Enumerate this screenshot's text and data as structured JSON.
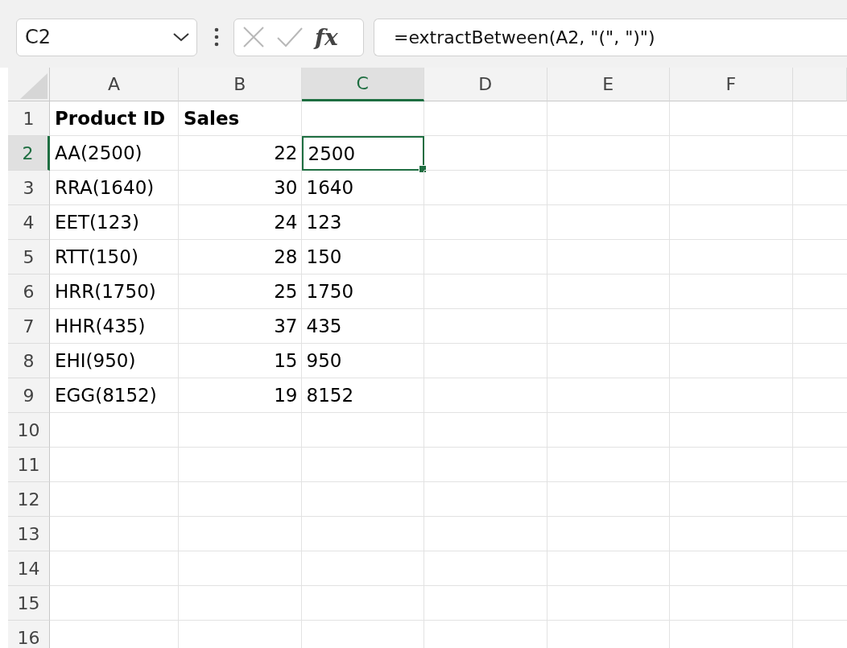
{
  "name_box": {
    "value": "C2"
  },
  "formula_bar": {
    "function_label": "fx",
    "value": "=extractBetween(A2, \"(\", \")\")"
  },
  "columns": [
    {
      "label": "A",
      "selected": false
    },
    {
      "label": "B",
      "selected": false
    },
    {
      "label": "C",
      "selected": true
    },
    {
      "label": "D",
      "selected": false
    },
    {
      "label": "E",
      "selected": false
    },
    {
      "label": "F",
      "selected": false
    }
  ],
  "rows": [
    {
      "header": "1",
      "selected": false,
      "cells": [
        {
          "text": "Product ID",
          "kind": "text",
          "bold": true,
          "selected": false
        },
        {
          "text": "Sales",
          "kind": "text",
          "bold": true,
          "selected": false
        }
      ]
    },
    {
      "header": "2",
      "selected": true,
      "cells": [
        {
          "text": "AA(2500)",
          "kind": "text",
          "bold": false,
          "selected": false
        },
        {
          "text": "22",
          "kind": "number",
          "bold": false,
          "selected": false
        },
        {
          "text": "2500",
          "kind": "text",
          "bold": false,
          "selected": true
        }
      ]
    },
    {
      "header": "3",
      "selected": false,
      "cells": [
        {
          "text": "RRA(1640)",
          "kind": "text",
          "bold": false,
          "selected": false
        },
        {
          "text": "30",
          "kind": "number",
          "bold": false,
          "selected": false
        },
        {
          "text": "1640",
          "kind": "text",
          "bold": false,
          "selected": false
        }
      ]
    },
    {
      "header": "4",
      "selected": false,
      "cells": [
        {
          "text": "EET(123)",
          "kind": "text",
          "bold": false,
          "selected": false
        },
        {
          "text": "24",
          "kind": "number",
          "bold": false,
          "selected": false
        },
        {
          "text": "123",
          "kind": "text",
          "bold": false,
          "selected": false
        }
      ]
    },
    {
      "header": "5",
      "selected": false,
      "cells": [
        {
          "text": "RTT(150)",
          "kind": "text",
          "bold": false,
          "selected": false
        },
        {
          "text": "28",
          "kind": "number",
          "bold": false,
          "selected": false
        },
        {
          "text": "150",
          "kind": "text",
          "bold": false,
          "selected": false
        }
      ]
    },
    {
      "header": "6",
      "selected": false,
      "cells": [
        {
          "text": "HRR(1750)",
          "kind": "text",
          "bold": false,
          "selected": false
        },
        {
          "text": "25",
          "kind": "number",
          "bold": false,
          "selected": false
        },
        {
          "text": "1750",
          "kind": "text",
          "bold": false,
          "selected": false
        }
      ]
    },
    {
      "header": "7",
      "selected": false,
      "cells": [
        {
          "text": "HHR(435)",
          "kind": "text",
          "bold": false,
          "selected": false
        },
        {
          "text": "37",
          "kind": "number",
          "bold": false,
          "selected": false
        },
        {
          "text": "435",
          "kind": "text",
          "bold": false,
          "selected": false
        }
      ]
    },
    {
      "header": "8",
      "selected": false,
      "cells": [
        {
          "text": "EHI(950)",
          "kind": "text",
          "bold": false,
          "selected": false
        },
        {
          "text": "15",
          "kind": "number",
          "bold": false,
          "selected": false
        },
        {
          "text": "950",
          "kind": "text",
          "bold": false,
          "selected": false
        }
      ]
    },
    {
      "header": "9",
      "selected": false,
      "cells": [
        {
          "text": "EGG(8152)",
          "kind": "text",
          "bold": false,
          "selected": false
        },
        {
          "text": "19",
          "kind": "number",
          "bold": false,
          "selected": false
        },
        {
          "text": "8152",
          "kind": "text",
          "bold": false,
          "selected": false
        }
      ]
    },
    {
      "header": "10",
      "selected": false,
      "cells": []
    },
    {
      "header": "11",
      "selected": false,
      "cells": []
    },
    {
      "header": "12",
      "selected": false,
      "cells": []
    },
    {
      "header": "13",
      "selected": false,
      "cells": []
    },
    {
      "header": "14",
      "selected": false,
      "cells": []
    },
    {
      "header": "15",
      "selected": false,
      "cells": []
    },
    {
      "header": "16",
      "selected": false,
      "cells": []
    }
  ]
}
